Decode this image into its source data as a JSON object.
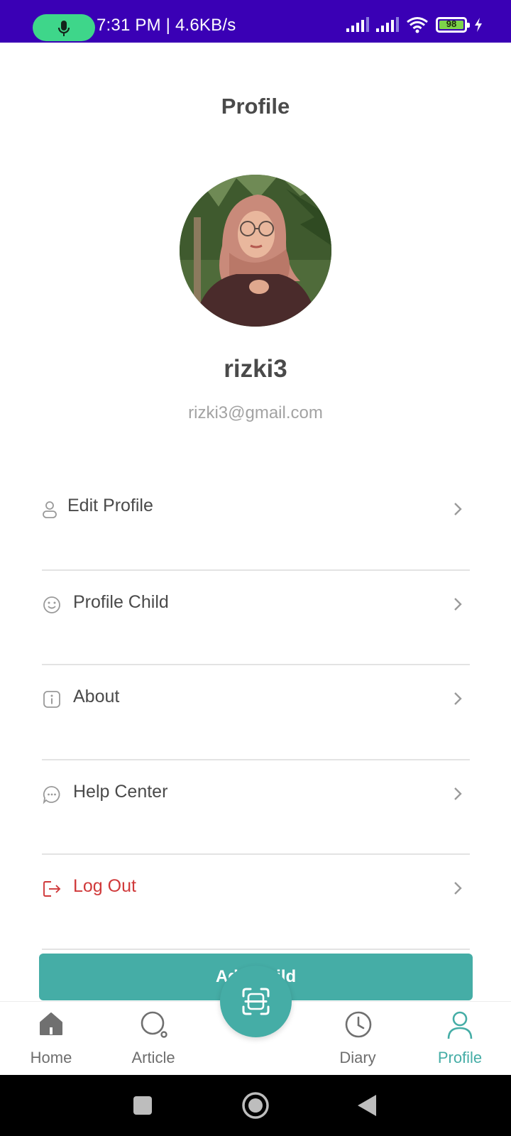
{
  "status_bar": {
    "time_speed": "7:31 PM | 4.6KB/s",
    "battery_level": "98",
    "background_color": "#3a00b5",
    "icons": [
      "microphone-icon",
      "signal-icon",
      "signal-icon",
      "wifi-icon",
      "battery-icon",
      "charging-icon"
    ]
  },
  "header": {
    "title": "Profile"
  },
  "user": {
    "name": "rizki3",
    "email": "rizki3@gmail.com"
  },
  "menu": {
    "items": [
      {
        "label": "Edit Profile",
        "icon": "user-icon"
      },
      {
        "label": "Profile Child",
        "icon": "smile-icon"
      },
      {
        "label": "About",
        "icon": "info-icon"
      },
      {
        "label": "Help Center",
        "icon": "chat-icon"
      },
      {
        "label": "Log Out",
        "icon": "logout-icon",
        "color": "#d0393a"
      }
    ]
  },
  "add_child_button": {
    "label": "Add Child",
    "color": "#45ada6"
  },
  "bottom_nav": {
    "items": [
      {
        "label": "Home",
        "icon": "home-icon"
      },
      {
        "label": "Article",
        "icon": "search-icon"
      },
      {
        "label": "Diary",
        "icon": "clock-icon"
      },
      {
        "label": "Profile",
        "icon": "user-icon",
        "active": true
      }
    ],
    "center_icon": "scan-icon",
    "active_color": "#45ada6"
  }
}
